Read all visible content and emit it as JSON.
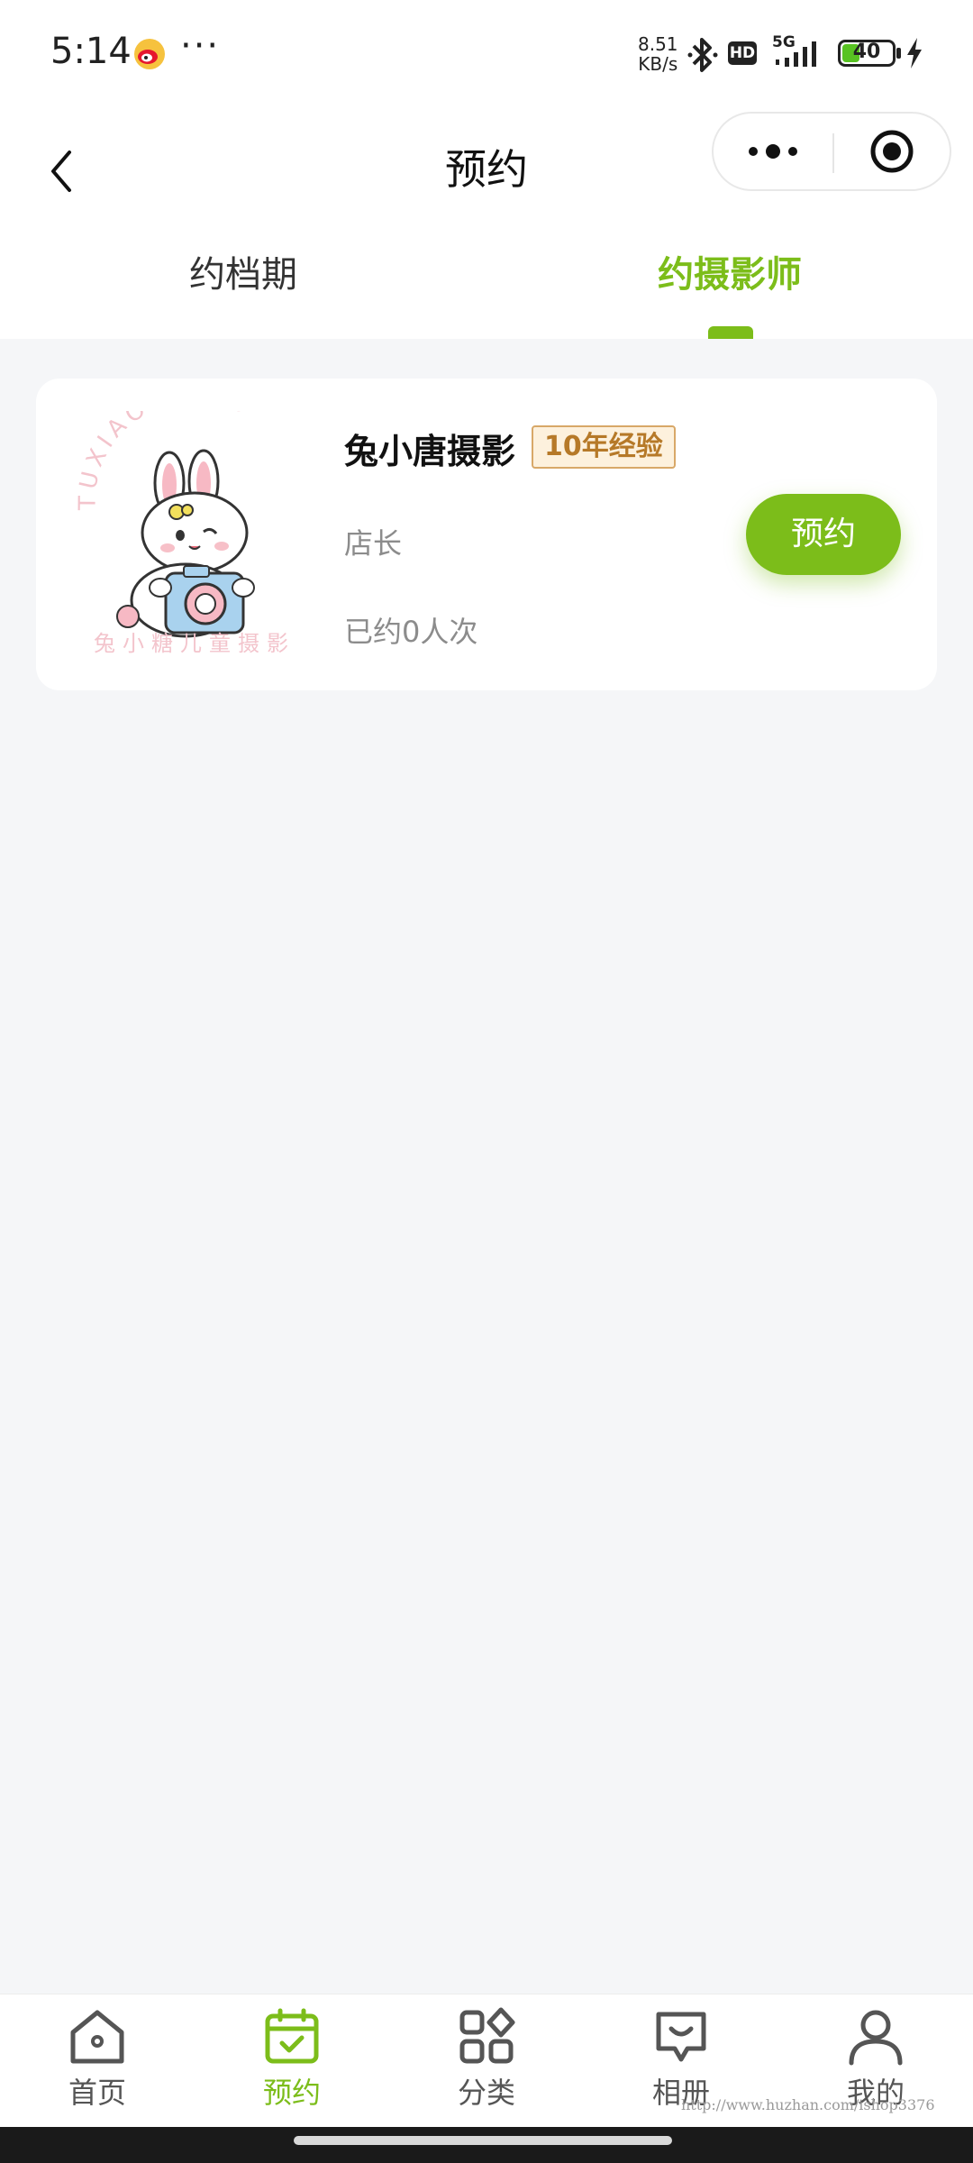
{
  "status_bar": {
    "time": "5:14",
    "dots": "···",
    "net_speed_value": "8.51",
    "net_speed_unit": "KB/s",
    "hd": "HD",
    "network": "5G",
    "battery": "40",
    "battery_level": 0.4
  },
  "nav": {
    "title": "预约"
  },
  "tabs": [
    {
      "label": "约档期",
      "active": false
    },
    {
      "label": "约摄影师",
      "active": true
    }
  ],
  "photographer": {
    "name": "兔小唐摄影",
    "badge": "10年经验",
    "role": "店长",
    "booked": "已约0人次",
    "button": "预约",
    "logo_top_text": "TUXIAO TANG",
    "logo_bottom_text": "兔小糖儿童摄影"
  },
  "tabbar": [
    {
      "label": "首页",
      "icon": "home-icon",
      "active": false
    },
    {
      "label": "预约",
      "icon": "calendar-check-icon",
      "active": true
    },
    {
      "label": "分类",
      "icon": "grid-icon",
      "active": false
    },
    {
      "label": "相册",
      "icon": "album-icon",
      "active": false
    },
    {
      "label": "我的",
      "icon": "user-icon",
      "active": false
    }
  ],
  "watermark": "http://www.huzhan.com/ishop3376",
  "colors": {
    "accent": "#7cbd1a",
    "badge_text": "#b67928",
    "badge_bg": "#fdf1dd",
    "page_bg": "#f5f6f8"
  }
}
